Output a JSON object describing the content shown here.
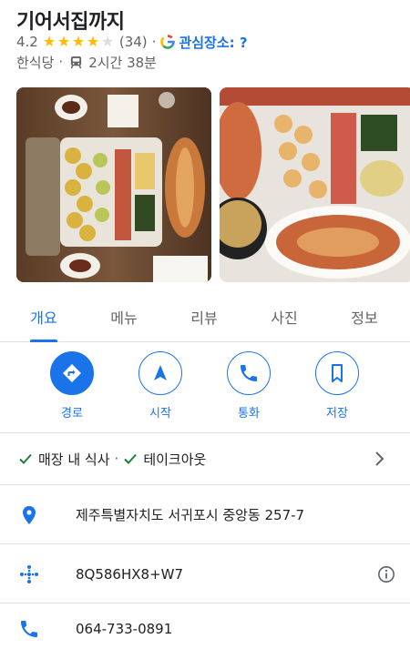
{
  "place": {
    "name": "기어서집까지",
    "rating": "4.2",
    "stars_filled": 4,
    "stars_total": 5,
    "review_count": "(34)",
    "interest_label": "관심장소: ?",
    "category": "한식당",
    "transit_time": "2시간 38분"
  },
  "tabs": [
    "개요",
    "메뉴",
    "리뷰",
    "사진",
    "정보"
  ],
  "actions": {
    "directions": "경로",
    "start": "시작",
    "call": "통화",
    "save": "저장"
  },
  "services": {
    "dine_in": "매장 내 식사",
    "takeout": "테이크아웃"
  },
  "details": {
    "address": "제주특별자치도 서귀포시 중앙동 257-7",
    "plus_code": "8Q586HX8+W7",
    "phone": "064-733-0891"
  },
  "colors": {
    "accent": "#1a73e8",
    "star": "#fbbc04",
    "check": "#188038"
  }
}
